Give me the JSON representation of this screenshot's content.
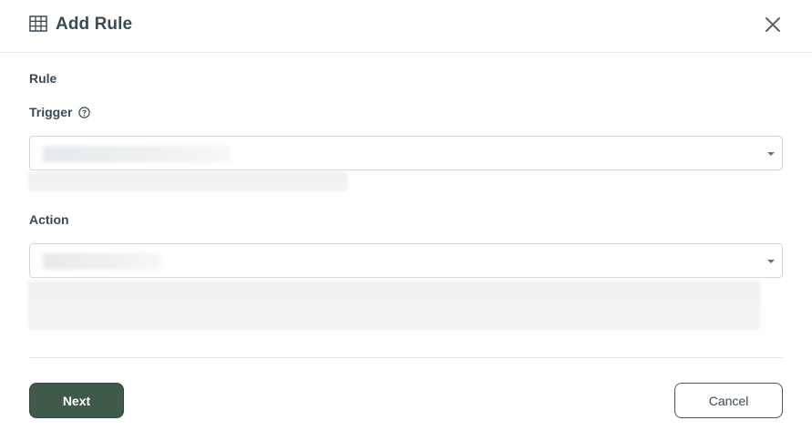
{
  "dialog": {
    "title": "Add Rule",
    "title_icon": "table-icon",
    "close_icon": "close-icon"
  },
  "form": {
    "section_label": "Rule",
    "trigger": {
      "label": "Trigger",
      "help_icon": "help-circle-icon"
    },
    "action": {
      "label": "Action"
    }
  },
  "footer": {
    "next_label": "Next",
    "cancel_label": "Cancel"
  },
  "colors": {
    "primary": "#3f5a48",
    "text": "#3a4a54",
    "border": "#d3d7da"
  }
}
